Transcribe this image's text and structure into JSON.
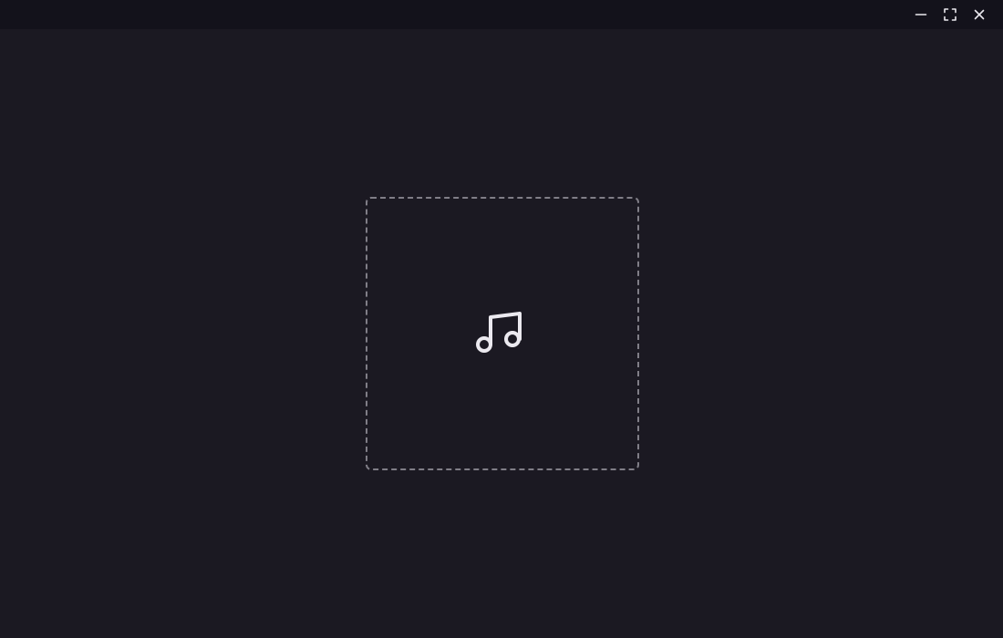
{
  "window": {
    "controls": [
      {
        "name": "minimize",
        "icon": "minimize-icon"
      },
      {
        "name": "maximize",
        "icon": "maximize-icon"
      },
      {
        "name": "close",
        "icon": "close-icon"
      }
    ]
  },
  "drop_zone": {
    "icon": "music-note-icon"
  },
  "colors": {
    "background": "#1b1922",
    "titlebar": "#13121b",
    "icon": "#ebe9ef",
    "dashed_border": "#807e87"
  }
}
